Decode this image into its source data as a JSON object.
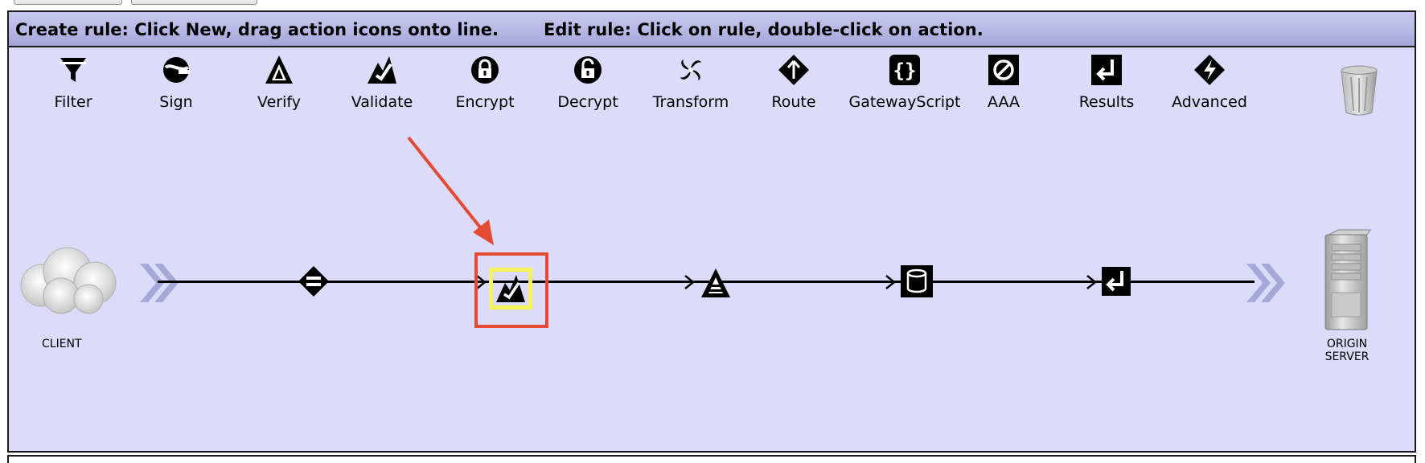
{
  "instructions": {
    "create": "Create rule: Click New, drag action icons onto line.",
    "edit": "Edit rule: Click on rule, double-click on action."
  },
  "palette": [
    {
      "label": "Filter",
      "icon": "filter-icon"
    },
    {
      "label": "Sign",
      "icon": "sign-icon"
    },
    {
      "label": "Verify",
      "icon": "verify-icon"
    },
    {
      "label": "Validate",
      "icon": "validate-icon"
    },
    {
      "label": "Encrypt",
      "icon": "encrypt-icon"
    },
    {
      "label": "Decrypt",
      "icon": "decrypt-icon"
    },
    {
      "label": "Transform",
      "icon": "transform-icon"
    },
    {
      "label": "Route",
      "icon": "route-icon"
    },
    {
      "label": "GatewayScript",
      "icon": "gatewayscript-icon"
    },
    {
      "label": "AAA",
      "icon": "aaa-icon"
    },
    {
      "label": "Results",
      "icon": "results-icon"
    },
    {
      "label": "Advanced",
      "icon": "advanced-icon"
    }
  ],
  "rule": {
    "actions": [
      "match-action",
      "validate-action",
      "verify-action",
      "result-store-action",
      "results-action"
    ],
    "selected_action": "validate-action"
  },
  "endpoints": {
    "client": "CLIENT",
    "server_line1": "ORIGIN",
    "server_line2": "SERVER"
  },
  "colors": {
    "canvas": "#dcdcfa",
    "highlight_red": "#e34a33",
    "highlight_yellow": "#f6f25a"
  }
}
